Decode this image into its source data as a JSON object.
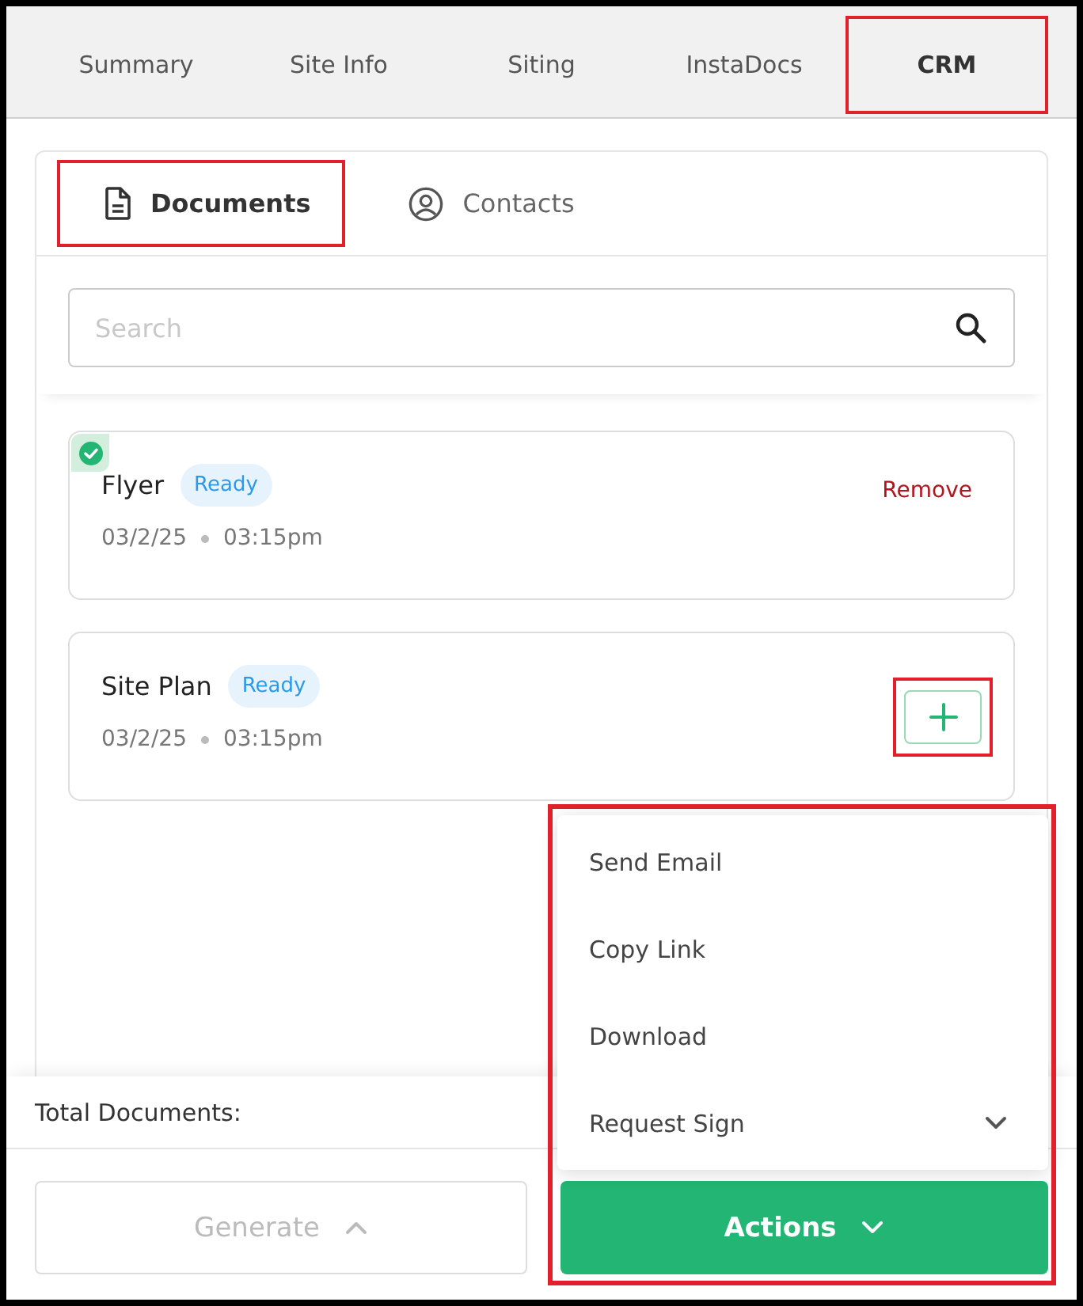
{
  "tabs": [
    {
      "label": "Summary",
      "selected": false,
      "highlighted": false
    },
    {
      "label": "Site Info",
      "selected": false,
      "highlighted": false
    },
    {
      "label": "Siting",
      "selected": false,
      "highlighted": false
    },
    {
      "label": "InstaDocs",
      "selected": false,
      "highlighted": false
    },
    {
      "label": "CRM",
      "selected": true,
      "highlighted": true
    }
  ],
  "subtabs": [
    {
      "label": "Documents",
      "kind": "document",
      "selected": true,
      "highlighted": true
    },
    {
      "label": "Contacts",
      "kind": "contact",
      "selected": false,
      "highlighted": false
    }
  ],
  "search": {
    "placeholder": "Search"
  },
  "documents": [
    {
      "name": "Flyer",
      "status": "Ready",
      "date": "03/2/25",
      "time": "03:15pm",
      "checked": true,
      "action": {
        "kind": "remove",
        "label": "Remove"
      }
    },
    {
      "name": "Site Plan",
      "status": "Ready",
      "date": "03/2/25",
      "time": "03:15pm",
      "checked": false,
      "action": {
        "kind": "add",
        "highlighted": true
      }
    }
  ],
  "footer": {
    "total_label": "Total Documents:"
  },
  "generate": {
    "label": "Generate",
    "disabled": true
  },
  "actions": {
    "label": "Actions",
    "highlighted": true,
    "expanded": true,
    "menu": [
      {
        "label": "Send Email",
        "has_submenu": false
      },
      {
        "label": "Copy Link",
        "has_submenu": false
      },
      {
        "label": "Download",
        "has_submenu": false
      },
      {
        "label": "Request Sign",
        "has_submenu": true
      }
    ]
  }
}
